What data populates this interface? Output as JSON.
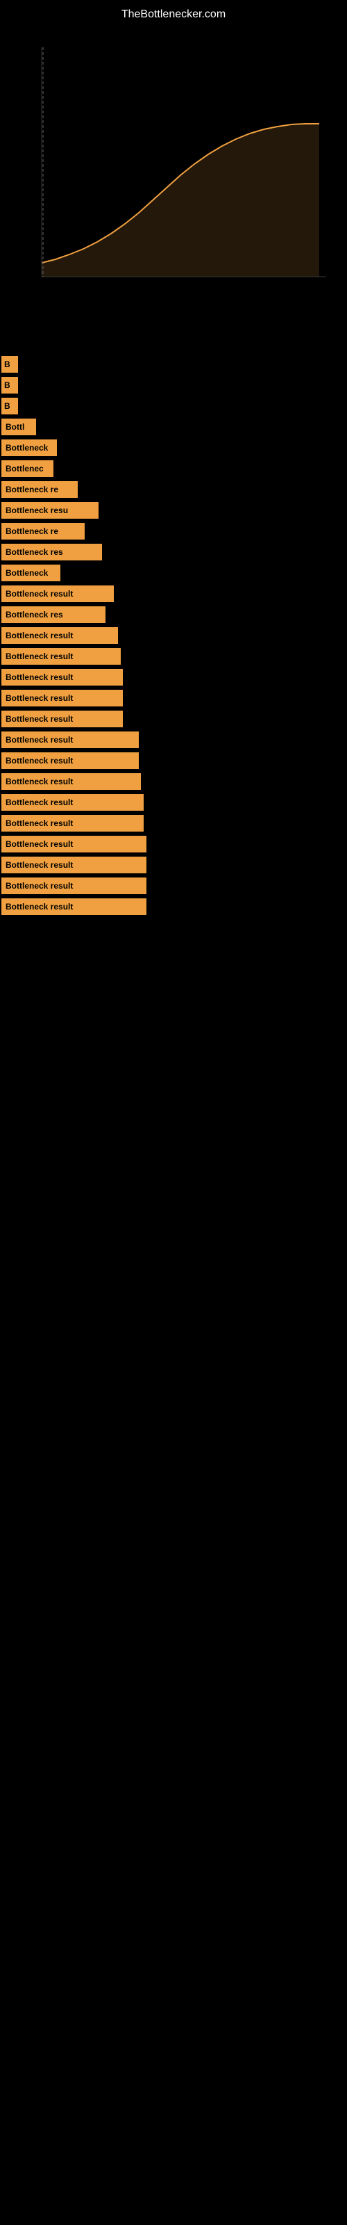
{
  "header": {
    "site_name": "TheBottlenecker.com"
  },
  "chart": {
    "description": "Bottleneck performance chart area"
  },
  "items": [
    {
      "id": 1,
      "label": ""
    },
    {
      "id": 2,
      "label": ""
    },
    {
      "id": 3,
      "label": ""
    },
    {
      "id": 4,
      "label": "B"
    },
    {
      "id": 5,
      "label": "Bo"
    },
    {
      "id": 6,
      "label": "Bo"
    },
    {
      "id": 7,
      "label": "Bottle"
    },
    {
      "id": 8,
      "label": "Bottleneck r"
    },
    {
      "id": 9,
      "label": "Bottlenec"
    },
    {
      "id": 10,
      "label": "Bottleneck re"
    },
    {
      "id": 11,
      "label": "Bottleneck"
    },
    {
      "id": 12,
      "label": "Bottleneck re"
    },
    {
      "id": 13,
      "label": "Bottleneck res"
    },
    {
      "id": 14,
      "label": "Bottleneck result"
    },
    {
      "id": 15,
      "label": "Bottleneck re"
    },
    {
      "id": 16,
      "label": "Bottleneck res"
    },
    {
      "id": 17,
      "label": "Bottleneck"
    },
    {
      "id": 18,
      "label": "Bottleneck result"
    },
    {
      "id": 19,
      "label": "Bottleneck res"
    },
    {
      "id": 20,
      "label": "Bottleneck result"
    },
    {
      "id": 21,
      "label": "Bottleneck result"
    },
    {
      "id": 22,
      "label": "Bottleneck result"
    },
    {
      "id": 23,
      "label": "Bottleneck result"
    },
    {
      "id": 24,
      "label": "Bottleneck result"
    },
    {
      "id": 25,
      "label": "Bottleneck result"
    },
    {
      "id": 26,
      "label": "Bottleneck result"
    },
    {
      "id": 27,
      "label": "Bottleneck result"
    },
    {
      "id": 28,
      "label": "Bottleneck result"
    },
    {
      "id": 29,
      "label": "Bottleneck result"
    },
    {
      "id": 30,
      "label": "Bottleneck result"
    },
    {
      "id": 31,
      "label": "Bottleneck result"
    }
  ]
}
